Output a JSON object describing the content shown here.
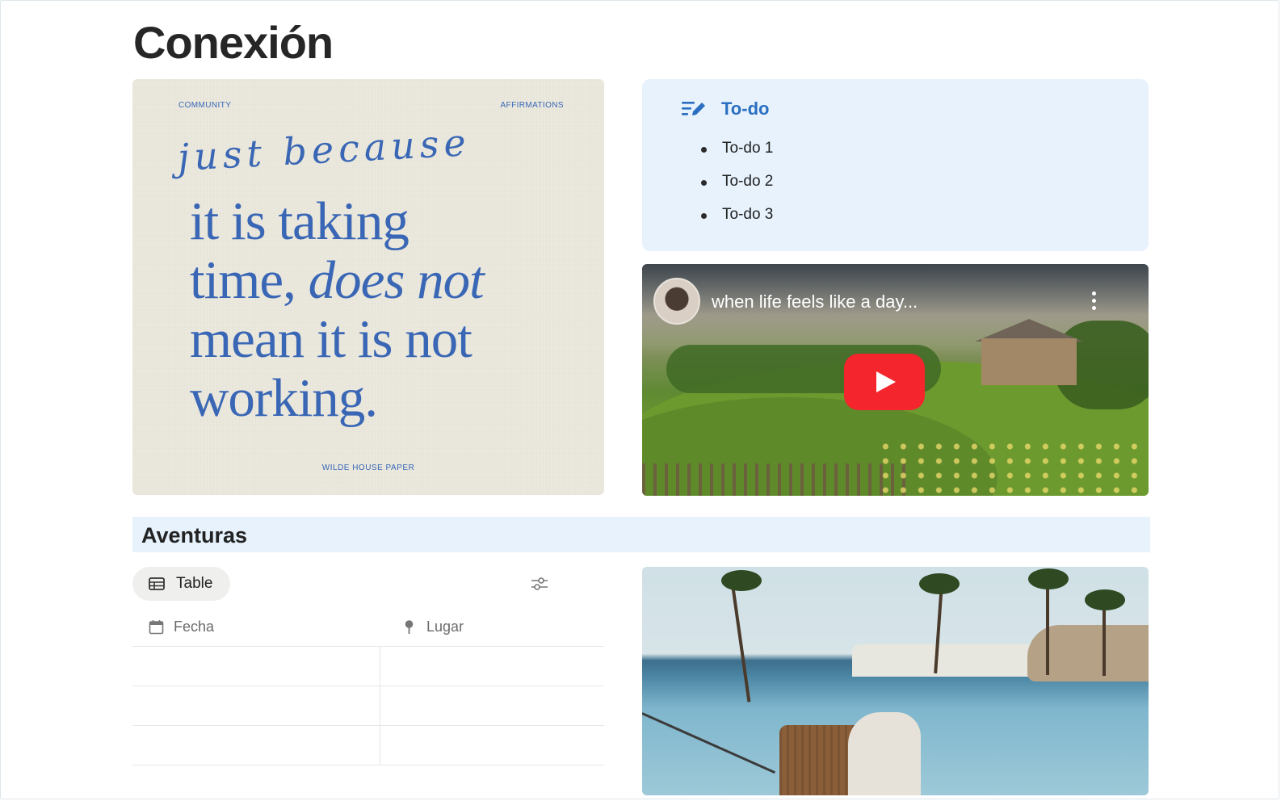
{
  "page": {
    "title": "Conexión"
  },
  "affirmation": {
    "tag_left": "COMMUNITY",
    "tag_right": "AFFIRMATIONS",
    "script": "just because",
    "line1": "it is taking",
    "line2_a": "time, ",
    "line2_b": "does not",
    "line3": "mean it is not",
    "line4": "working.",
    "brand": "WILDE HOUSE PAPER"
  },
  "todo": {
    "icon": "edit-list-icon",
    "title": "To-do",
    "items": [
      "To-do 1",
      "To-do 2",
      "To-do 3"
    ]
  },
  "video": {
    "title": "when life feels like a day...",
    "play_icon": "youtube-play-icon",
    "menu_icon": "more-vertical-icon"
  },
  "section": {
    "title": "Aventuras"
  },
  "view": {
    "tab_label": "Table",
    "tab_icon": "table-icon",
    "settings_icon": "sliders-icon",
    "columns": [
      {
        "label": "Fecha",
        "icon": "calendar-icon"
      },
      {
        "label": "Lugar",
        "icon": "pin-icon"
      }
    ],
    "rows": [
      {
        "fecha": "",
        "lugar": ""
      },
      {
        "fecha": "",
        "lugar": ""
      },
      {
        "fecha": "",
        "lugar": ""
      }
    ]
  },
  "colors": {
    "accent": "#2a6fc0",
    "callout_bg": "#e7f2fd",
    "affirmation_blue": "#3a67b5",
    "youtube_red": "#f4252d"
  }
}
